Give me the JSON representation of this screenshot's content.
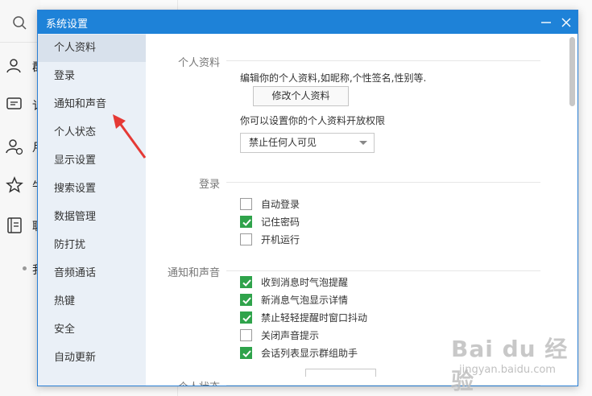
{
  "background": {
    "fragments": [
      "群",
      "讠",
      "月",
      "牛",
      "联",
      "我"
    ]
  },
  "dialog": {
    "title": "系统设置",
    "minimize_glyph": "—",
    "close_glyph": "✕"
  },
  "sidebar": {
    "items": [
      {
        "label": "个人资料",
        "active": true
      },
      {
        "label": "登录",
        "active": false
      },
      {
        "label": "通知和声音",
        "active": false
      },
      {
        "label": "个人状态",
        "active": false
      },
      {
        "label": "显示设置",
        "active": false
      },
      {
        "label": "搜索设置",
        "active": false
      },
      {
        "label": "数据管理",
        "active": false
      },
      {
        "label": "防打扰",
        "active": false
      },
      {
        "label": "音频通话",
        "active": false
      },
      {
        "label": "热键",
        "active": false
      },
      {
        "label": "安全",
        "active": false
      },
      {
        "label": "自动更新",
        "active": false
      }
    ]
  },
  "sections": {
    "profile": {
      "title": "个人资料",
      "description": "编辑你的个人资料,如昵称,个性签名,性别等.",
      "edit_button": "修改个人资料",
      "permission_text": "你可以设置你的个人资料开放权限",
      "permission_select": "禁止任何人可见"
    },
    "login": {
      "title": "登录",
      "options": [
        {
          "label": "自动登录",
          "checked": false
        },
        {
          "label": "记住密码",
          "checked": true
        },
        {
          "label": "开机运行",
          "checked": false
        }
      ]
    },
    "notify": {
      "title": "通知和声音",
      "options": [
        {
          "label": "收到消息时气泡提醒",
          "checked": true
        },
        {
          "label": "新消息气泡显示详情",
          "checked": true
        },
        {
          "label": "禁止轻轻提醒时窗口抖动",
          "checked": true
        },
        {
          "label": "关闭声音提示",
          "checked": false
        },
        {
          "label": "会话列表显示群组助手",
          "checked": true
        }
      ]
    },
    "status": {
      "title": "个人状态"
    }
  },
  "watermark": {
    "main": "Bai du 经验",
    "sub": "jingyan.baidu.com"
  },
  "colors": {
    "titlebar": "#1e82d8",
    "sidebar_bg": "#eaf0f7",
    "sidebar_active": "#d8e1ec",
    "checkbox_checked": "#2fa34b",
    "annotation_arrow": "#e53935"
  }
}
